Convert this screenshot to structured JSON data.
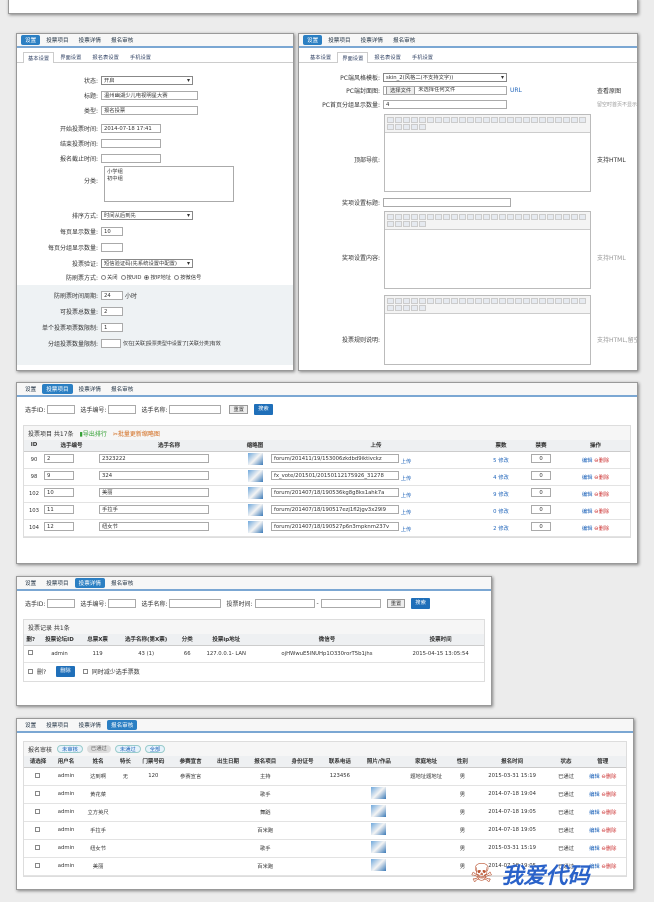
{
  "nav": [
    "设置",
    "投票项目",
    "投票详情",
    "报名审核"
  ],
  "settings": {
    "subtabs": [
      "基本设置",
      "界面设置",
      "报名表设置",
      "手机设置"
    ],
    "fields": [
      {
        "label": "状态:",
        "value": "开启",
        "type": "select"
      },
      {
        "label": "标题:",
        "value": "温州幽湖少儿电视明星大赛",
        "type": "input"
      },
      {
        "label": "类型:",
        "value": "报名投票",
        "type": "input"
      },
      {
        "label": "开始投票时间:",
        "value": "2014-07-18 17:41",
        "type": "input"
      },
      {
        "label": "结束投票时间:",
        "value": "",
        "type": "input"
      },
      {
        "label": "报名截止时间:",
        "value": "",
        "type": "input"
      }
    ],
    "category_label": "分类:",
    "category_values": [
      "小学组",
      "初中组"
    ],
    "sort_label": "排序方式:",
    "sort_value": "时间从后到先",
    "perpage_label": "每页显示数量:",
    "perpage_value": "10",
    "group_label": "每页分组显示数量:",
    "group_value": "",
    "verify_label": "投票验证:",
    "verify_value": "短信验证码(先系统设置中配置)",
    "antibrush_label": "防刷票方式:",
    "antibrush_opts": [
      "关闭",
      "按UID",
      "按IP地址",
      "按微信号"
    ],
    "period_label": "防刷票时间周期:",
    "period_value": "24",
    "period_unit": "小时",
    "total_label": "可投票总数量:",
    "total_value": "2",
    "single_label": "单个投票项票数限制:",
    "single_value": "1",
    "grouplimit_label": "分组投票数量限制:",
    "grouplimit_note": "仅在[关联]投票类型中设置了[关联分类]有效"
  },
  "ui": {
    "subtabs": [
      "基本设置",
      "界面设置",
      "报名表设置",
      "手机设置"
    ],
    "pc_tpl_label": "PC端风格模板:",
    "pc_tpl_value": "skin_2(风格二(不支持文字))",
    "pc_img_label": "PC端封面图:",
    "choose_file": "选择文件",
    "no_file": "未选择任何文件",
    "url": "URL",
    "view": "查看原图",
    "pc_group_label": "PC首页分组显示数量:",
    "pc_group_value": "4",
    "pc_group_note": "留空时首页不显示",
    "top_nav_label": "顶部导航:",
    "html_note": "支持HTML",
    "award_title_label": "奖项设置标题:",
    "award_content_label": "奖项设置内容:",
    "award_note": "支持HTML",
    "rule_label": "投票规则说明:",
    "rule_note": "支持HTML,留空"
  },
  "items": {
    "search": {
      "id_label": "选手ID:",
      "no_label": "选手编号:",
      "name_label": "选手名称:",
      "reset": "重置",
      "search": "搜索"
    },
    "summary": "投票项目 共17条",
    "export": "导出排行",
    "batch": "批量更新缩略图",
    "headers": [
      "ID",
      "选手编号",
      "选手名称",
      "缩略图",
      "上传",
      "票数",
      "禁赛",
      "操作"
    ],
    "rows": [
      {
        "id": "90",
        "no": "2",
        "name": "2323222",
        "file": "forum/201411/19/153006zkdbd9iktivckz",
        "votes": "5",
        "ban": "0"
      },
      {
        "id": "98",
        "no": "9",
        "name": "324",
        "file": "fx_vote/201501/20150112175926_31278",
        "votes": "4",
        "ban": "0"
      },
      {
        "id": "102",
        "no": "10",
        "name": "美丽",
        "file": "forum/201407/18/190536kg8g8ks1ahk7a",
        "votes": "9",
        "ban": "0"
      },
      {
        "id": "103",
        "no": "11",
        "name": "手拉手",
        "file": "forum/201407/18/190517ezj1fl2jgv3x29l9",
        "votes": "0",
        "ban": "0"
      },
      {
        "id": "104",
        "no": "12",
        "name": "纽女节",
        "file": "forum/201407/18/190527p6n3mpknm237v",
        "votes": "2",
        "ban": "0"
      }
    ],
    "upload": "上传",
    "edit_vote": "修改",
    "edit": "编辑",
    "del": "删除"
  },
  "detail": {
    "search": {
      "id_label": "选手ID:",
      "no_label": "选手编号:",
      "name_label": "选手名称:",
      "time_label": "投票时间:",
      "sep": "-",
      "reset": "重置",
      "search": "搜索"
    },
    "summary": "投票记录 共1条",
    "headers": [
      "删?",
      "投票论坛ID",
      "总票X票",
      "选手名称(第X票)",
      "分类",
      "投票ip地址",
      "微信号",
      "投票时间"
    ],
    "row": {
      "user": "admin",
      "fid": "119",
      "name": "43 (1)",
      "cat": "66",
      "ip": "127.0.0.1- LAN",
      "wx": "ojHWwuE5lNUHp1O330rorT5b1jhs",
      "time": "2015-04-15 13:05:54"
    },
    "del_label": "删?",
    "delete_btn": "删除",
    "reduce_label": "同时减少选手票数"
  },
  "review": {
    "label": "报名审核",
    "filters": [
      "未审核",
      "已通过",
      "未通过",
      "全部"
    ],
    "headers": [
      "请选择",
      "用户名",
      "姓名",
      "特长",
      "门票号码",
      "参赛宣言",
      "出生日期",
      "报名项目",
      "身份证号",
      "联系电话",
      "照片/作品",
      "家庭地址",
      "性别",
      "报名时间",
      "状态",
      "管理"
    ],
    "rows": [
      {
        "user": "admin",
        "name": "达到啊",
        "spec": "无",
        "ticket": "120",
        "decl": "参赛宣言",
        "proj": "主持",
        "phone": "123456",
        "addr": "题地址题地址",
        "sex": "男",
        "time": "2015-03-31 15:19",
        "photo": false
      },
      {
        "user": "admin",
        "name": "黄花菜",
        "spec": "",
        "ticket": "",
        "decl": "",
        "proj": "歌手",
        "phone": "",
        "addr": "",
        "sex": "男",
        "time": "2014-07-18 19:04",
        "photo": true
      },
      {
        "user": "admin",
        "name": "立方英尺",
        "spec": "",
        "ticket": "",
        "decl": "",
        "proj": "舞蹈",
        "phone": "",
        "addr": "",
        "sex": "男",
        "time": "2014-07-18 19:05",
        "photo": true
      },
      {
        "user": "admin",
        "name": "手拉手",
        "spec": "",
        "ticket": "",
        "decl": "",
        "proj": "百米跑",
        "phone": "",
        "addr": "",
        "sex": "男",
        "time": "2014-07-18 19:05",
        "photo": true
      },
      {
        "user": "admin",
        "name": "纽女节",
        "spec": "",
        "ticket": "",
        "decl": "",
        "proj": "歌手",
        "phone": "",
        "addr": "",
        "sex": "男",
        "time": "2015-03-31 15:19",
        "photo": true
      },
      {
        "user": "admin",
        "name": "美丽",
        "spec": "",
        "ticket": "",
        "decl": "",
        "proj": "百米跑",
        "phone": "",
        "addr": "",
        "sex": "男",
        "time": "2014-07-18 19:05",
        "photo": true
      }
    ],
    "status": "已通过",
    "edit": "编辑",
    "del": "删除"
  },
  "watermark": "我爱代码"
}
